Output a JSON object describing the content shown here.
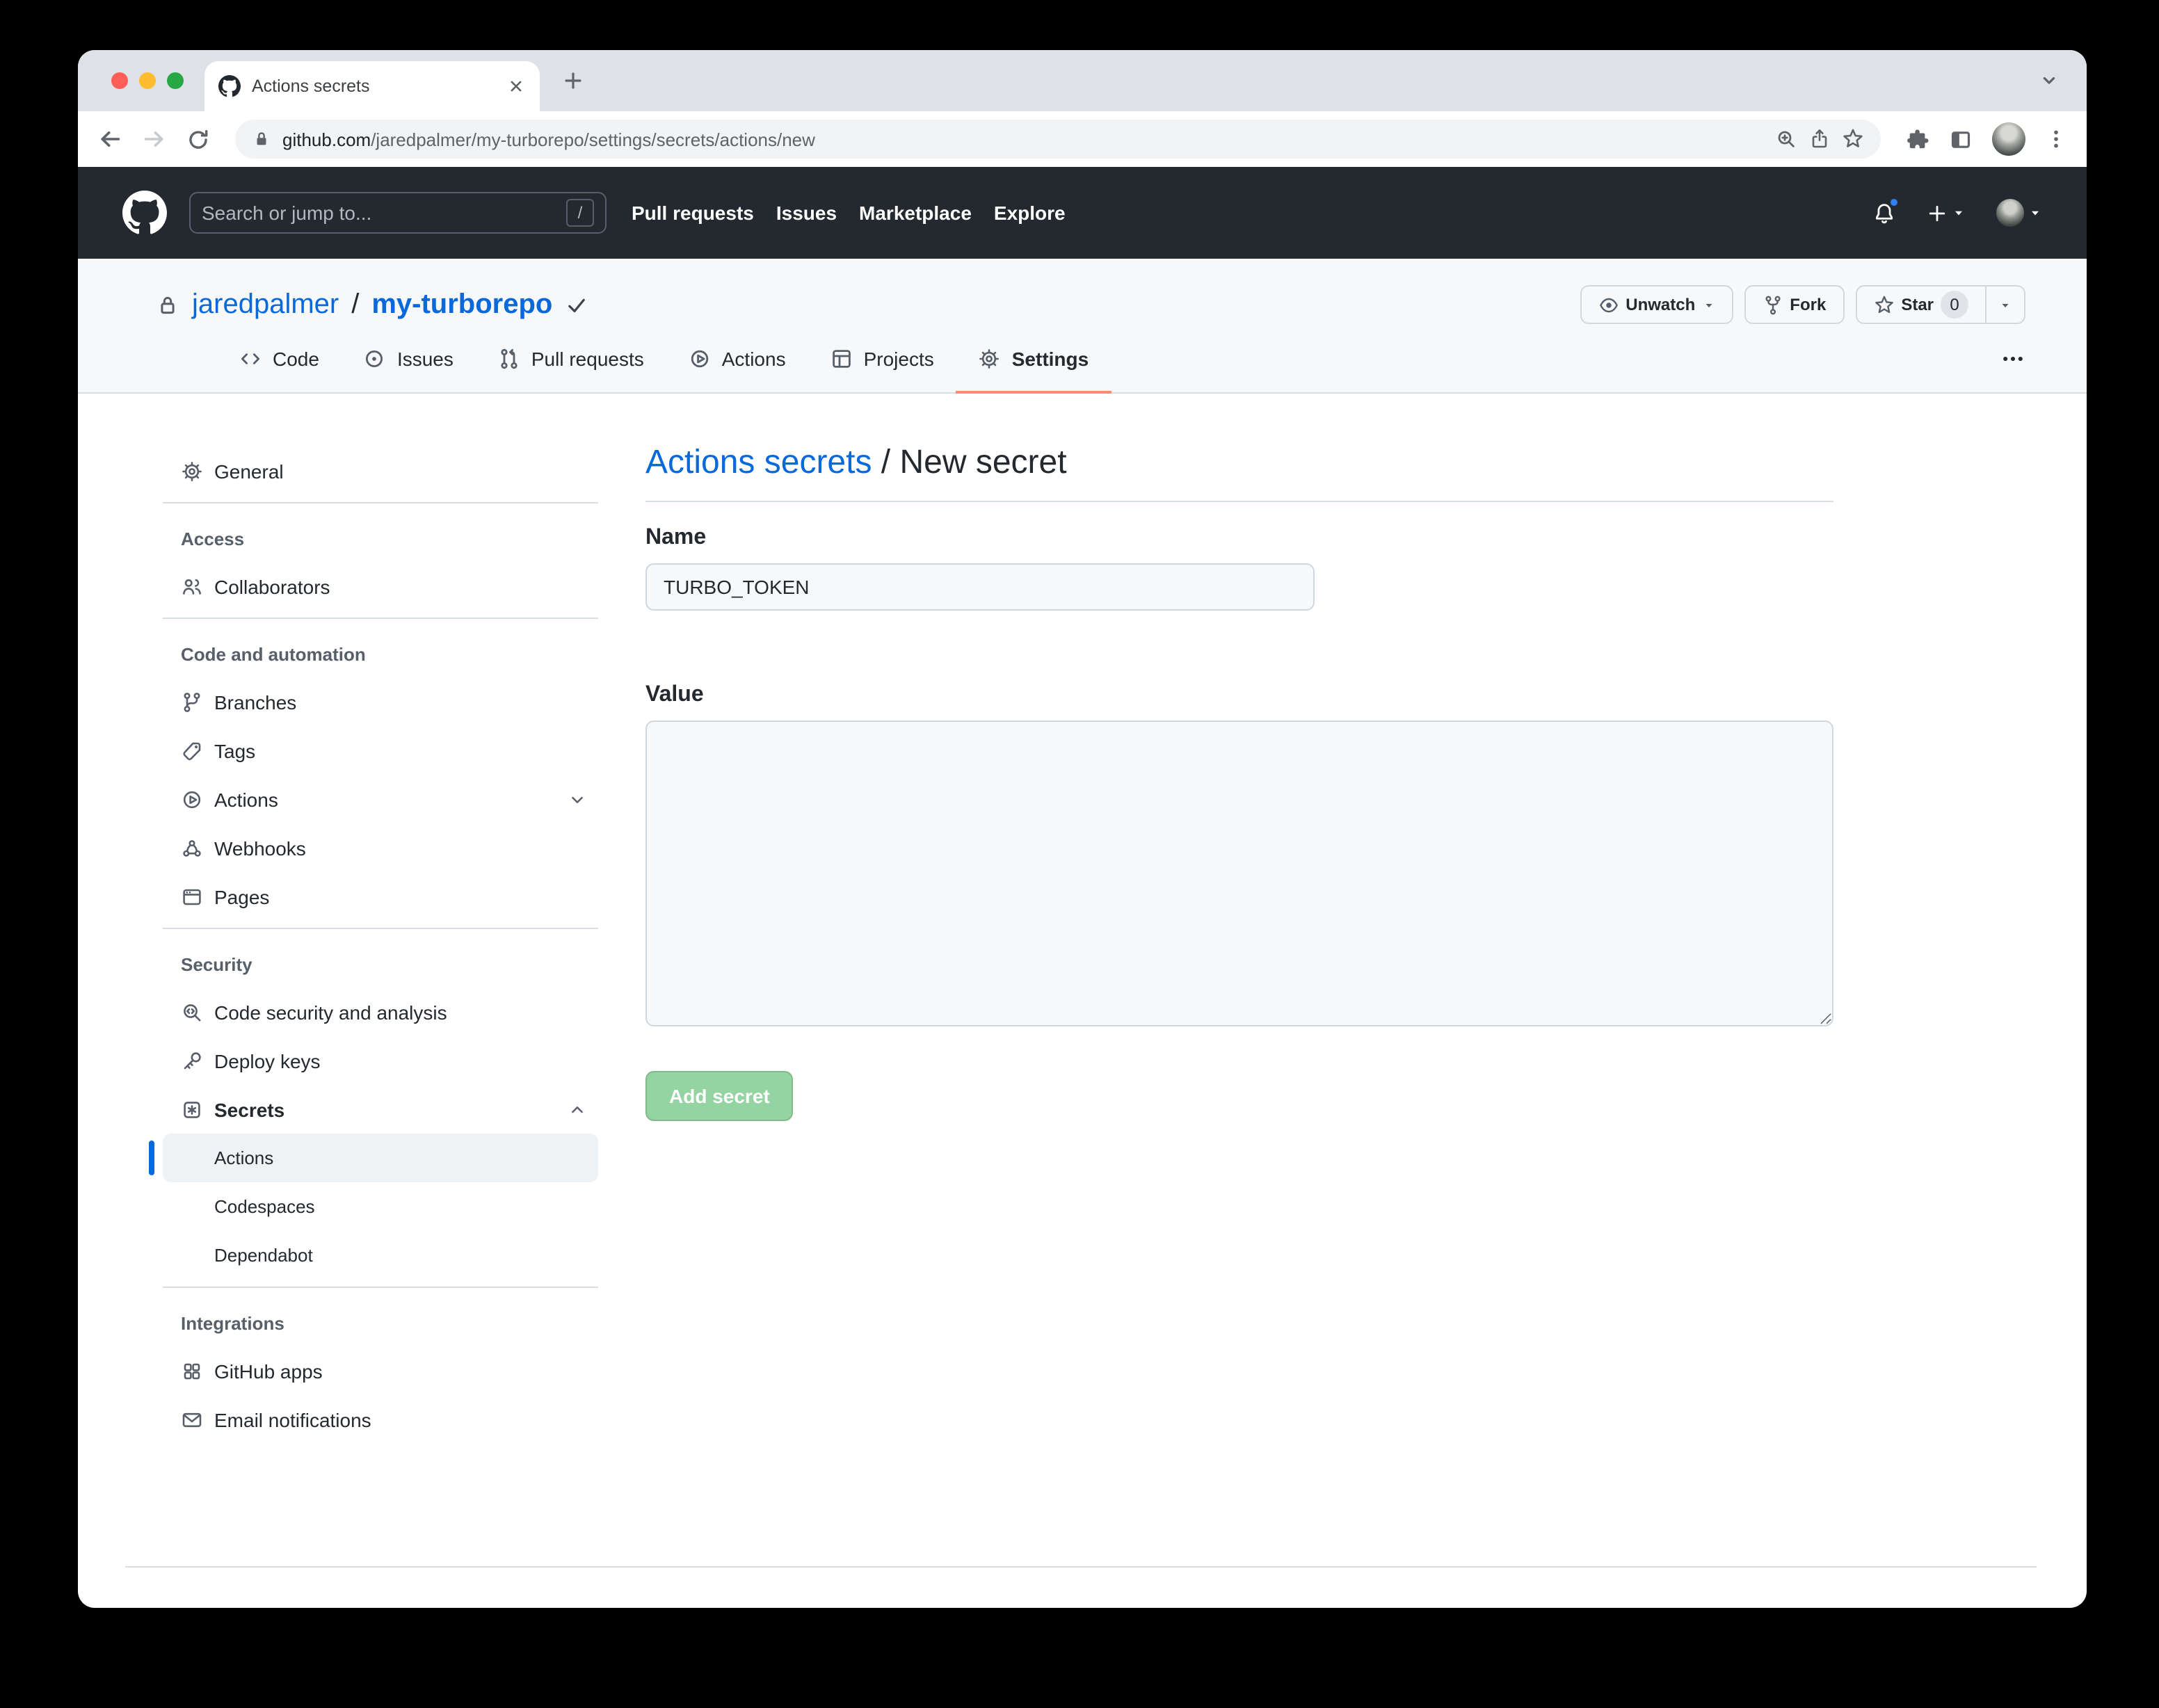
{
  "colors": {
    "accent_blue": "#0969da",
    "header_bg": "#24292f",
    "active_tab_underline": "#fd8c73",
    "disabled_green_button": "#94d3a2",
    "panel_gray": "#f6f8fa"
  },
  "browser": {
    "tab_title": "Actions secrets",
    "url_host": "github.com",
    "url_path": "/jaredpalmer/my-turborepo/settings/secrets/actions/new"
  },
  "header": {
    "search_placeholder": "Search or jump to...",
    "search_key_hint": "/",
    "nav": [
      {
        "label": "Pull requests"
      },
      {
        "label": "Issues"
      },
      {
        "label": "Marketplace"
      },
      {
        "label": "Explore"
      }
    ]
  },
  "repo": {
    "owner": "jaredpalmer",
    "separator": "/",
    "name": "my-turborepo",
    "buttons": {
      "unwatch": "Unwatch",
      "fork": "Fork",
      "star": "Star",
      "star_count": "0"
    }
  },
  "repo_tabs": [
    {
      "label": "Code"
    },
    {
      "label": "Issues"
    },
    {
      "label": "Pull requests"
    },
    {
      "label": "Actions"
    },
    {
      "label": "Projects"
    },
    {
      "label": "Settings"
    }
  ],
  "sidebar": {
    "general": "General",
    "access_header": "Access",
    "collaborators": "Collaborators",
    "code_header": "Code and automation",
    "branches": "Branches",
    "tags": "Tags",
    "actions": "Actions",
    "webhooks": "Webhooks",
    "pages": "Pages",
    "security_header": "Security",
    "code_security": "Code security and analysis",
    "deploy_keys": "Deploy keys",
    "secrets": "Secrets",
    "secrets_sub": {
      "actions": "Actions",
      "codespaces": "Codespaces",
      "dependabot": "Dependabot"
    },
    "integrations_header": "Integrations",
    "github_apps": "GitHub apps",
    "email_notifications": "Email notifications"
  },
  "main": {
    "breadcrumb_link": "Actions secrets",
    "breadcrumb_separator": " / ",
    "breadcrumb_current": "New secret",
    "name_label": "Name",
    "name_value": "TURBO_TOKEN",
    "value_label": "Value",
    "add_button": "Add secret"
  }
}
